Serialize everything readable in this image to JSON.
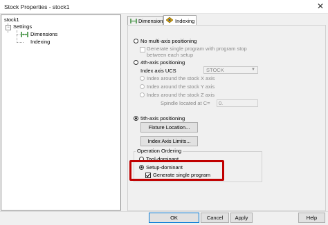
{
  "window": {
    "title": "Stock Properties - stock1",
    "close_glyph": "✕"
  },
  "tree": {
    "root": "stock1",
    "settings": "Settings",
    "settings_toggle": "−",
    "dimensions": "Dimensions",
    "indexing": "Indexing"
  },
  "tabs": [
    {
      "label": "Dimensions",
      "icon": "dimensions-icon",
      "active": false
    },
    {
      "label": "Indexing",
      "icon": "indexing-icon",
      "active": true
    }
  ],
  "indexing": {
    "no_multi_axis": "No multi-axis positioning",
    "generate_single_setup": "Generate single program with program stop between each setup",
    "fourth_axis": "4th-axis positioning",
    "index_axis_ucs_label": "Index axis UCS",
    "index_axis_ucs_value": "STOCK",
    "around_x": "Index around the stock X axis",
    "around_y": "Index around the stock Y axis",
    "around_z": "Index around the stock Z axis",
    "spindle_label": "Spindle located at C=",
    "spindle_value": "0.",
    "fifth_axis": "5th-axis positioning",
    "fixture_location": "Fixture Location...",
    "index_axis_limits": "Index Axis Limits...",
    "operation_ordering": "Operation Ordering",
    "tool_dominant": "Tool-dominant",
    "setup_dominant": "Setup-dominant",
    "generate_single_program": "Generate single program"
  },
  "buttons": {
    "ok": "OK",
    "cancel": "Cancel",
    "apply": "Apply",
    "help": "Help"
  },
  "colors": {
    "highlight": "#c00000",
    "default_button_border": "#0078d7"
  }
}
